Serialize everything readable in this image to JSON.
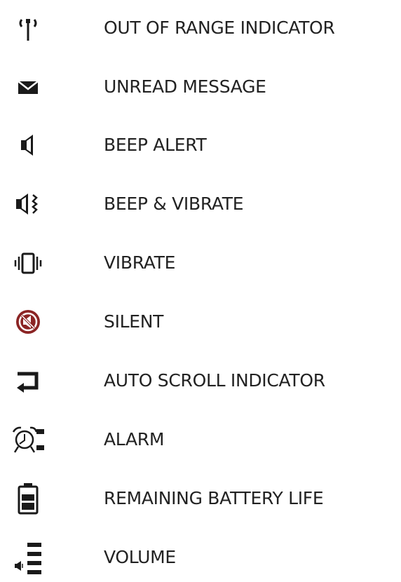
{
  "colors": {
    "icon": "#1a1a1a",
    "silent_accent": "#8b2424",
    "text": "#222222",
    "background": "#ffffff"
  },
  "legend": {
    "items": [
      {
        "icon": "antenna-icon",
        "label": "OUT OF RANGE INDICATOR"
      },
      {
        "icon": "envelope-icon",
        "label": "UNREAD MESSAGE"
      },
      {
        "icon": "speaker-icon",
        "label": "BEEP ALERT"
      },
      {
        "icon": "speaker-vibrate-icon",
        "label": "BEEP & VIBRATE"
      },
      {
        "icon": "vibrate-icon",
        "label": "VIBRATE"
      },
      {
        "icon": "silent-icon",
        "label": "SILENT"
      },
      {
        "icon": "return-arrow-icon",
        "label": "AUTO SCROLL INDICATOR"
      },
      {
        "icon": "alarm-clock-icon",
        "label": "ALARM"
      },
      {
        "icon": "battery-icon",
        "label": "REMAINING BATTERY LIFE"
      },
      {
        "icon": "volume-icon",
        "label": "VOLUME"
      }
    ]
  }
}
